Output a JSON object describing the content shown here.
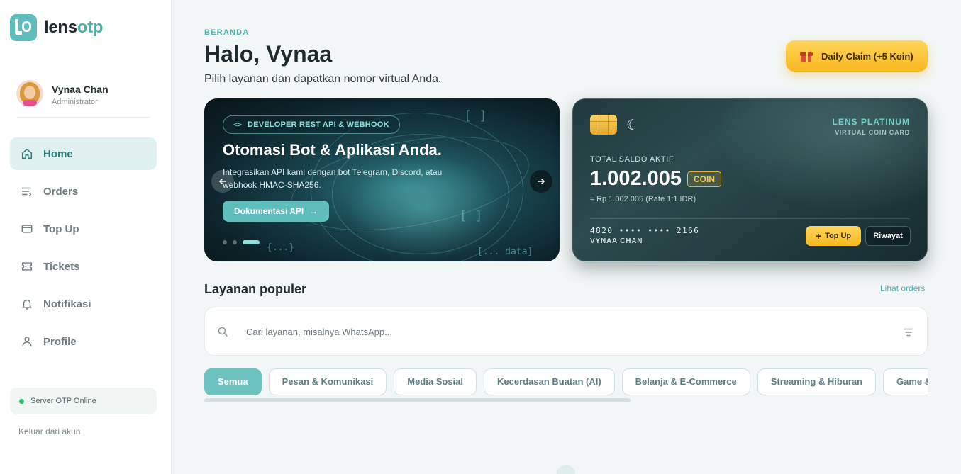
{
  "brand": {
    "name_prefix": "lens",
    "name_accent": "otp"
  },
  "user": {
    "name": "Vynaa Chan",
    "role": "Administrator"
  },
  "nav": {
    "items": [
      {
        "label": "Home",
        "icon": "home-icon",
        "active": true
      },
      {
        "label": "Orders",
        "icon": "list-icon",
        "active": false
      },
      {
        "label": "Top Up",
        "icon": "wallet-icon",
        "active": false
      },
      {
        "label": "Tickets",
        "icon": "ticket-icon",
        "active": false
      },
      {
        "label": "Notifikasi",
        "icon": "bell-icon",
        "active": false
      },
      {
        "label": "Profile",
        "icon": "user-icon",
        "active": false
      }
    ]
  },
  "server_status": {
    "label": "Server OTP Online",
    "color": "#2cbf74"
  },
  "logout_label": "Keluar dari akun",
  "header": {
    "breadcrumb": "BERANDA",
    "title": "Halo, Vynaa",
    "subtitle": "Pilih layanan dan dapatkan nomor virtual Anda."
  },
  "daily_claim": {
    "label": "Daily Claim (+5 Koin)",
    "icon": "gift-icon"
  },
  "promo": {
    "badge": "DEVELOPER REST API & WEBHOOK",
    "badge_icon": "code-icon",
    "title": "Otomasi Bot & Aplikasi Anda.",
    "description": "Integrasikan API kami dengan bot Telegram, Discord, atau webhook HMAC-SHA256.",
    "button_label": "Dokumentasi API",
    "code_fragment_1": "[ ]",
    "code_fragment_2": "{...}",
    "code_fragment_3": "[... data]",
    "slides_total": 3,
    "slide_active": 3
  },
  "coin_card": {
    "brand": "LENS PLATINUM",
    "brand_sub": "VIRTUAL COIN CARD",
    "balance_label": "TOTAL SALDO AKTIF",
    "balance": "1.002.005",
    "unit": "COIN",
    "idr_equiv": "≈ Rp 1.002.005 (Rate 1:1 IDR)",
    "card_number": "4820 •••• •••• 2166",
    "holder": "VYNAA CHAN",
    "topup_label": "Top Up",
    "history_label": "Riwayat"
  },
  "services": {
    "title": "Layanan populer",
    "link": "Lihat orders",
    "search_placeholder": "Cari layanan, misalnya WhatsApp...",
    "categories": [
      {
        "label": "Semua",
        "active": true
      },
      {
        "label": "Pesan & Komunikasi",
        "active": false
      },
      {
        "label": "Media Sosial",
        "active": false
      },
      {
        "label": "Kecerdasan Buatan (AI)",
        "active": false
      },
      {
        "label": "Belanja & E-Commerce",
        "active": false
      },
      {
        "label": "Streaming & Hiburan",
        "active": false
      },
      {
        "label": "Game & Esport",
        "active": false
      }
    ]
  },
  "colors": {
    "accent": "#4fb1af",
    "accent_soft": "#dff1f0",
    "gold": "#f8b81f",
    "card_dark": "#1f3a3e"
  }
}
